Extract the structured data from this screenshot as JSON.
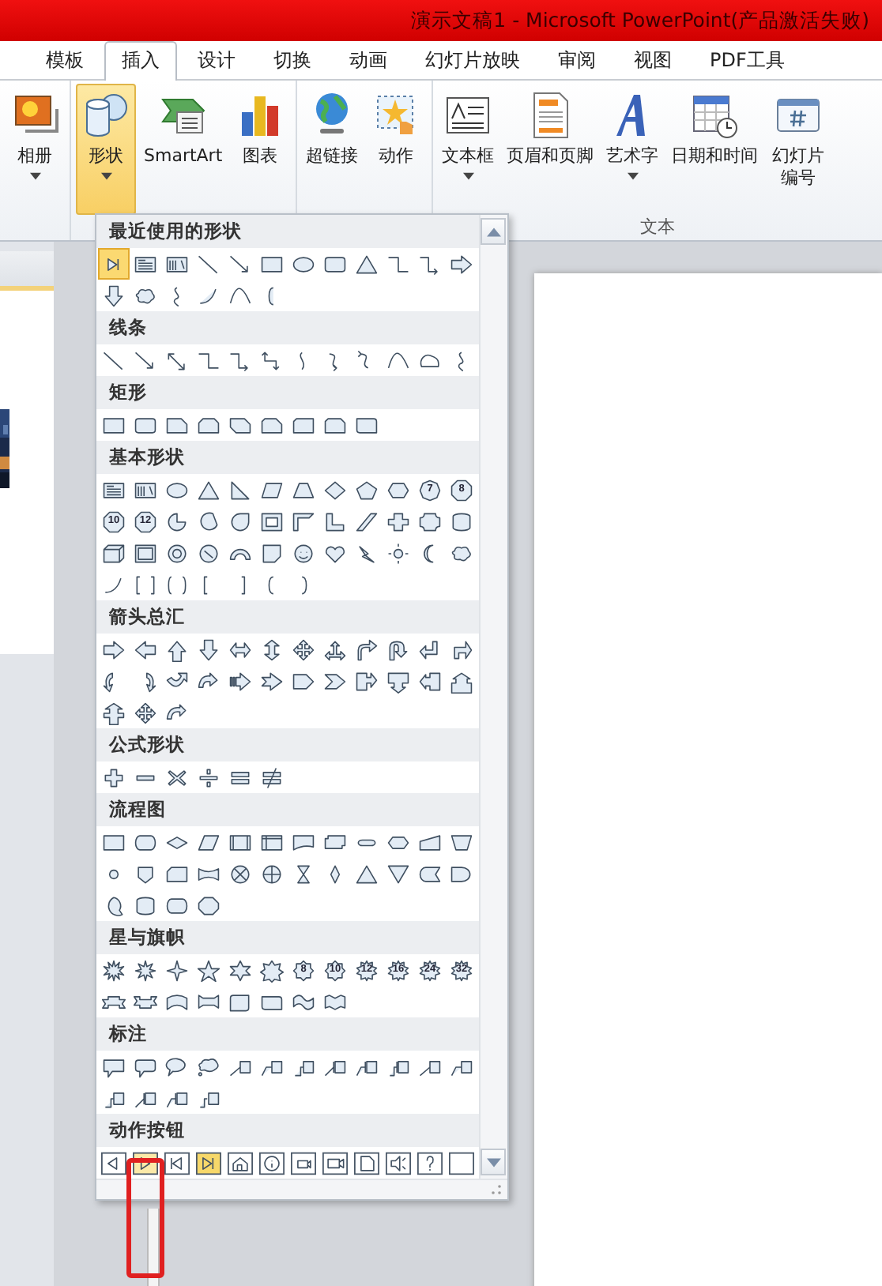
{
  "title_bar": {
    "title": "演示文稿1  -  Microsoft PowerPoint(产品激活失败)"
  },
  "tabs": [
    {
      "label": "模板",
      "selected": false
    },
    {
      "label": "插入",
      "selected": true
    },
    {
      "label": "设计",
      "selected": false
    },
    {
      "label": "切换",
      "selected": false
    },
    {
      "label": "动画",
      "selected": false
    },
    {
      "label": "幻灯片放映",
      "selected": false
    },
    {
      "label": "审阅",
      "selected": false
    },
    {
      "label": "视图",
      "selected": false
    },
    {
      "label": "PDF工具",
      "selected": false
    }
  ],
  "ribbon": {
    "groups": [
      {
        "buttons": [
          {
            "label": "相册",
            "kind": "album",
            "dropdown": true,
            "selected": false
          }
        ]
      },
      {
        "buttons": [
          {
            "label": "形状",
            "kind": "shapes",
            "dropdown": true,
            "selected": true
          },
          {
            "label": "SmartArt",
            "kind": "smartart",
            "dropdown": false,
            "selected": false
          },
          {
            "label": "图表",
            "kind": "chart",
            "dropdown": false,
            "selected": false
          }
        ]
      },
      {
        "buttons": [
          {
            "label": "超链接",
            "kind": "link",
            "dropdown": false,
            "selected": false
          },
          {
            "label": "动作",
            "kind": "action",
            "dropdown": false,
            "selected": false
          }
        ]
      },
      {
        "label": "文本",
        "buttons": [
          {
            "label": "文本框",
            "kind": "textbox",
            "dropdown": true,
            "selected": false
          },
          {
            "label": "页眉和页脚",
            "kind": "header",
            "dropdown": false,
            "selected": false
          },
          {
            "label": "艺术字",
            "kind": "wordart",
            "dropdown": true,
            "selected": false
          },
          {
            "label": "日期和时间",
            "kind": "datetime",
            "dropdown": false,
            "selected": false
          },
          {
            "label": "幻灯片编号",
            "kind": "slidenum",
            "dropdown": false,
            "selected": false
          }
        ]
      }
    ]
  },
  "shapes_gallery": {
    "sections": [
      {
        "title": "最近使用的形状",
        "kind": "recent",
        "items": [
          {
            "selected": true
          },
          {
            "selected": false
          },
          {
            "selected": false
          },
          {
            "selected": false
          },
          {
            "selected": false
          },
          {
            "selected": false
          },
          {
            "selected": false
          },
          {
            "selected": false
          },
          {
            "selected": false
          },
          {
            "selected": false
          },
          {
            "selected": false
          },
          {
            "selected": false
          },
          {
            "selected": false
          },
          {
            "selected": false
          },
          {
            "selected": false
          },
          {
            "selected": false
          },
          {
            "selected": false
          },
          {
            "selected": false
          }
        ]
      },
      {
        "title": "线条",
        "kind": "lines",
        "items": [
          {
            "selected": false
          },
          {
            "selected": false
          },
          {
            "selected": false
          },
          {
            "selected": false
          },
          {
            "selected": false
          },
          {
            "selected": false
          },
          {
            "selected": false
          },
          {
            "selected": false
          },
          {
            "selected": false
          },
          {
            "selected": false
          },
          {
            "selected": false
          },
          {
            "selected": false
          }
        ]
      },
      {
        "title": "矩形",
        "kind": "rects",
        "items": [
          {
            "selected": false
          },
          {
            "selected": false
          },
          {
            "selected": false
          },
          {
            "selected": false
          },
          {
            "selected": false
          },
          {
            "selected": false
          },
          {
            "selected": false
          },
          {
            "selected": false
          },
          {
            "selected": false
          }
        ]
      },
      {
        "title": "基本形状",
        "kind": "basic",
        "items": [
          {
            "selected": false
          },
          {
            "selected": false
          },
          {
            "selected": false
          },
          {
            "selected": false
          },
          {
            "selected": false
          },
          {
            "selected": false
          },
          {
            "selected": false
          },
          {
            "selected": false
          },
          {
            "selected": false
          },
          {
            "selected": false
          },
          {
            "label": "7",
            "selected": false
          },
          {
            "label": "8",
            "selected": false
          },
          {
            "label": "10",
            "selected": false
          },
          {
            "label": "12",
            "selected": false
          },
          {
            "selected": false
          },
          {
            "selected": false
          },
          {
            "selected": false
          },
          {
            "selected": false
          },
          {
            "selected": false
          },
          {
            "selected": false
          },
          {
            "selected": false
          },
          {
            "selected": false
          },
          {
            "selected": false
          },
          {
            "selected": false
          },
          {
            "selected": false
          },
          {
            "selected": false
          },
          {
            "selected": false
          },
          {
            "selected": false
          },
          {
            "selected": false
          },
          {
            "selected": false
          },
          {
            "selected": false
          },
          {
            "selected": false
          },
          {
            "selected": false
          },
          {
            "selected": false
          },
          {
            "selected": false
          },
          {
            "selected": false
          },
          {
            "selected": false
          },
          {
            "selected": false
          },
          {
            "selected": false
          },
          {
            "selected": false
          },
          {
            "selected": false
          },
          {
            "selected": false
          },
          {
            "selected": false
          }
        ]
      },
      {
        "title": "箭头总汇",
        "kind": "arrows",
        "items": [
          {
            "selected": false
          },
          {
            "selected": false
          },
          {
            "selected": false
          },
          {
            "selected": false
          },
          {
            "selected": false
          },
          {
            "selected": false
          },
          {
            "selected": false
          },
          {
            "selected": false
          },
          {
            "selected": false
          },
          {
            "selected": false
          },
          {
            "selected": false
          },
          {
            "selected": false
          },
          {
            "selected": false
          },
          {
            "selected": false
          },
          {
            "selected": false
          },
          {
            "selected": false
          },
          {
            "selected": false
          },
          {
            "selected": false
          },
          {
            "selected": false
          },
          {
            "selected": false
          },
          {
            "selected": false
          },
          {
            "selected": false
          },
          {
            "selected": false
          },
          {
            "selected": false
          },
          {
            "selected": false
          },
          {
            "selected": false
          },
          {
            "selected": false
          }
        ]
      },
      {
        "title": "公式形状",
        "kind": "equation",
        "items": [
          {
            "selected": false
          },
          {
            "selected": false
          },
          {
            "selected": false
          },
          {
            "selected": false
          },
          {
            "selected": false
          },
          {
            "selected": false
          }
        ]
      },
      {
        "title": "流程图",
        "kind": "flowchart",
        "items": [
          {
            "selected": false
          },
          {
            "selected": false
          },
          {
            "selected": false
          },
          {
            "selected": false
          },
          {
            "selected": false
          },
          {
            "selected": false
          },
          {
            "selected": false
          },
          {
            "selected": false
          },
          {
            "selected": false
          },
          {
            "selected": false
          },
          {
            "selected": false
          },
          {
            "selected": false
          },
          {
            "selected": false
          },
          {
            "selected": false
          },
          {
            "selected": false
          },
          {
            "selected": false
          },
          {
            "selected": false
          },
          {
            "selected": false
          },
          {
            "selected": false
          },
          {
            "selected": false
          },
          {
            "selected": false
          },
          {
            "selected": false
          },
          {
            "selected": false
          },
          {
            "selected": false
          },
          {
            "selected": false
          },
          {
            "selected": false
          },
          {
            "selected": false
          },
          {
            "selected": false
          }
        ]
      },
      {
        "title": "星与旗帜",
        "kind": "stars",
        "items": [
          {
            "selected": false
          },
          {
            "selected": false
          },
          {
            "selected": false
          },
          {
            "selected": false
          },
          {
            "selected": false
          },
          {
            "selected": false
          },
          {
            "label": "8",
            "selected": false
          },
          {
            "label": "10",
            "selected": false
          },
          {
            "label": "12",
            "selected": false
          },
          {
            "label": "16",
            "selected": false
          },
          {
            "label": "24",
            "selected": false
          },
          {
            "label": "32",
            "selected": false
          },
          {
            "selected": false
          },
          {
            "selected": false
          },
          {
            "selected": false
          },
          {
            "selected": false
          },
          {
            "selected": false
          },
          {
            "selected": false
          },
          {
            "selected": false
          },
          {
            "selected": false
          }
        ]
      },
      {
        "title": "标注",
        "kind": "callouts",
        "items": [
          {
            "selected": false
          },
          {
            "selected": false
          },
          {
            "selected": false
          },
          {
            "selected": false
          },
          {
            "selected": false
          },
          {
            "selected": false
          },
          {
            "selected": false
          },
          {
            "selected": false
          },
          {
            "selected": false
          },
          {
            "selected": false
          },
          {
            "selected": false
          },
          {
            "selected": false
          },
          {
            "selected": false
          },
          {
            "selected": false
          },
          {
            "selected": false
          },
          {
            "selected": false
          }
        ]
      },
      {
        "title": "动作按钮",
        "kind": "action",
        "items": [
          {
            "selected": false,
            "hovered": false
          },
          {
            "selected": false,
            "hovered": true
          },
          {
            "selected": false,
            "hovered": false
          },
          {
            "selected": true,
            "hovered": false
          },
          {
            "selected": false,
            "hovered": false
          },
          {
            "selected": false,
            "hovered": false
          },
          {
            "selected": false,
            "hovered": false
          },
          {
            "selected": false,
            "hovered": false
          },
          {
            "selected": false,
            "hovered": false
          },
          {
            "selected": false,
            "hovered": false
          },
          {
            "selected": false,
            "hovered": false
          },
          {
            "selected": false,
            "hovered": false
          }
        ]
      }
    ]
  }
}
